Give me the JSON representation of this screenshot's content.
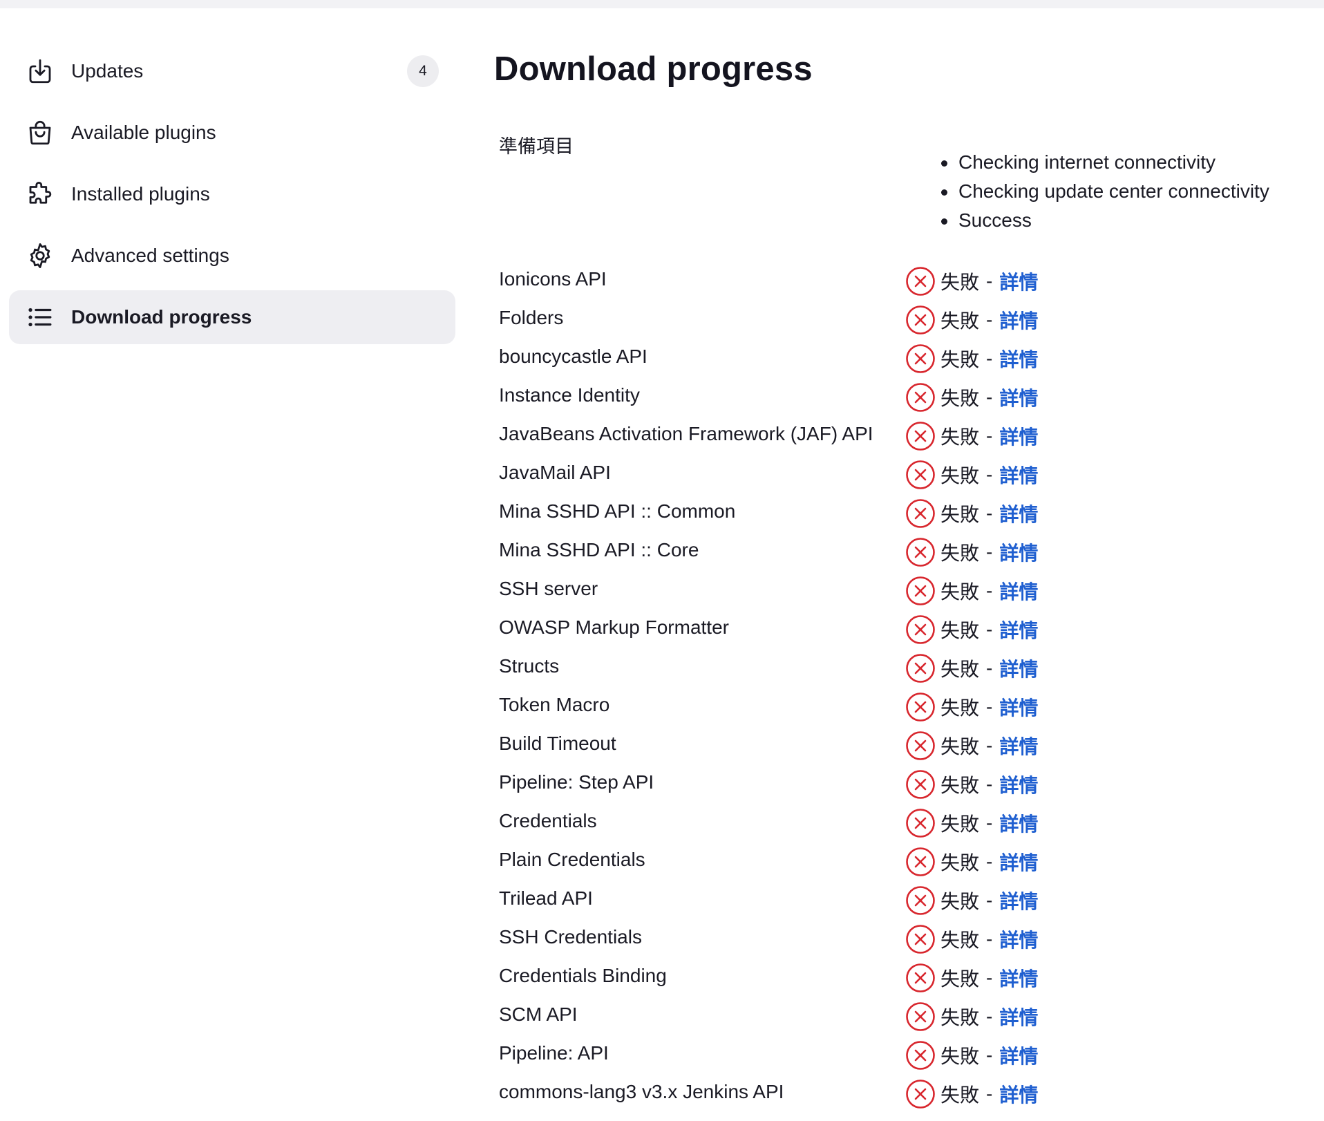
{
  "sidebar": {
    "items": [
      {
        "label": "Updates",
        "icon": "download-icon",
        "badge": "4",
        "active": false
      },
      {
        "label": "Available plugins",
        "icon": "shopping-bag-icon",
        "active": false
      },
      {
        "label": "Installed plugins",
        "icon": "puzzle-icon",
        "active": false
      },
      {
        "label": "Advanced settings",
        "icon": "gear-icon",
        "active": false
      },
      {
        "label": "Download progress",
        "icon": "list-icon",
        "active": true
      }
    ]
  },
  "main": {
    "title": "Download progress",
    "preparation": {
      "label": "準備項目",
      "steps": [
        "Checking internet connectivity",
        "Checking update center connectivity",
        "Success"
      ]
    },
    "status_text": "失敗",
    "separator": "-",
    "details_label": "詳情",
    "plugins": [
      "Ionicons API",
      "Folders",
      "bouncycastle API",
      "Instance Identity",
      "JavaBeans Activation Framework (JAF) API",
      "JavaMail API",
      "Mina SSHD API :: Common",
      "Mina SSHD API :: Core",
      "SSH server",
      "OWASP Markup Formatter",
      "Structs",
      "Token Macro",
      "Build Timeout",
      "Pipeline: Step API",
      "Credentials",
      "Plain Credentials",
      "Trilead API",
      "SSH Credentials",
      "Credentials Binding",
      "SCM API",
      "Pipeline: API",
      "commons-lang3 v3.x Jenkins API"
    ]
  },
  "colors": {
    "accent_link": "#1f5fd0",
    "error": "#d8262d",
    "active_bg": "#eeeef2"
  }
}
